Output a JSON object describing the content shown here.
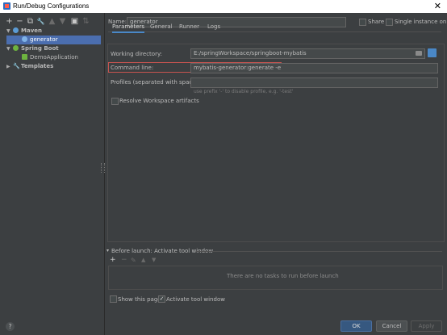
{
  "window": {
    "title": "Run/Debug Configurations",
    "close_glyph": "✕"
  },
  "left": {
    "toolbar": [
      "+",
      "−",
      "⧉",
      "🔧",
      "▲",
      "▼",
      "▣",
      "⇅"
    ],
    "tree": [
      {
        "label": "Maven",
        "icon": "maven-icon",
        "expanded": true
      },
      {
        "label": "generator",
        "icon": "maven-config-icon",
        "selected": true
      },
      {
        "label": "Spring Boot",
        "icon": "spring-boot-icon",
        "expanded": true
      },
      {
        "label": "DemoApplication",
        "icon": "spring-app-icon"
      },
      {
        "label": "Templates",
        "icon": "wrench-icon",
        "expanded": false
      }
    ]
  },
  "form": {
    "name_label": "Name:",
    "name_value": "generator",
    "share_label": "Share",
    "single_instance_label": "Single instance only",
    "tabs": [
      "Parameters",
      "General",
      "Runner",
      "Logs"
    ],
    "working_dir_label": "Working directory:",
    "working_dir_value": "E:/springWorkspace/springboot-mybatis",
    "command_line_label": "Command line:",
    "command_line_value": "mybatis-generator:generate -e",
    "profiles_label": "Profiles (separated with space):",
    "profiles_value": "",
    "profiles_hint": "use prefix '-' to disable profile, e.g. '-test'",
    "resolve_label": "Resolve Workspace artifacts"
  },
  "before_launch": {
    "title": "Before launch: Activate tool window",
    "toolbar": [
      "+",
      "−",
      "✎",
      "▲",
      "▼"
    ],
    "empty_text": "There are no tasks to run before launch",
    "show_page_label": "Show this page",
    "activate_label": "Activate tool window"
  },
  "buttons": {
    "ok": "OK",
    "cancel": "Cancel",
    "apply": "Apply",
    "help": "?"
  },
  "colors": {
    "accent": "#4a88c7",
    "selection": "#4b6eaf",
    "error_outline": "#c75450"
  }
}
